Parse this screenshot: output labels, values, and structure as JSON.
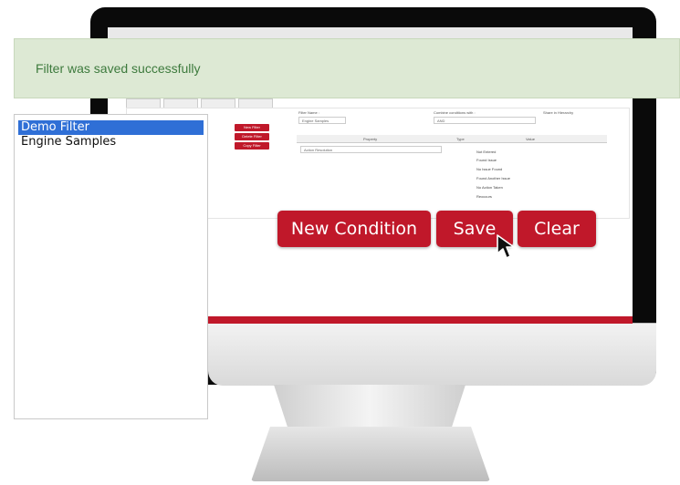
{
  "notification": {
    "message": "Filter was saved successfully"
  },
  "filter_list": {
    "items": [
      {
        "label": "Demo Filter",
        "selected": true
      },
      {
        "label": "Engine Samples",
        "selected": false
      }
    ]
  },
  "actions": {
    "new_condition": "New Condition",
    "save": "Save",
    "clear": "Clear"
  },
  "background_app": {
    "filter_buttons": [
      "New Filter",
      "Delete Filter",
      "Copy Filter"
    ],
    "filter_name_label": "Filter Name :",
    "filter_name_value": "Engine Samples",
    "combine_label": "Combine conditions with :",
    "combine_value": "AND",
    "hierarchy_label": "Share in Hierarchy",
    "columns": [
      "Property",
      "Type",
      "Value"
    ],
    "property_value": "Action Resolution",
    "value_options": [
      "Not Entered",
      "Found Issue",
      "No Issue Found",
      "Found Another Issue",
      "No Action Taken",
      "Reoccurs"
    ]
  },
  "colors": {
    "brand_red": "#c0182a",
    "success_bg": "#dde9d4",
    "success_text": "#3d7a3d",
    "selection_blue": "#2f6fd6"
  }
}
